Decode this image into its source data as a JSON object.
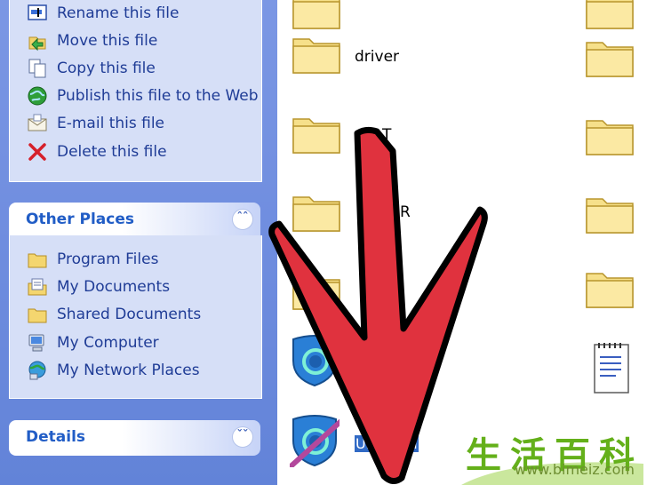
{
  "file_tasks": {
    "items": [
      {
        "label": "Rename this file",
        "icon": "rename-icon"
      },
      {
        "label": "Move this file",
        "icon": "move-icon"
      },
      {
        "label": "Copy this file",
        "icon": "copy-icon"
      },
      {
        "label": "Publish this file to the Web",
        "icon": "globe-icon"
      },
      {
        "label": "E-mail this file",
        "icon": "email-icon"
      },
      {
        "label": "Delete this file",
        "icon": "delete-icon"
      }
    ]
  },
  "other_places": {
    "title": "Other Places",
    "items": [
      {
        "label": "Program Files",
        "icon": "folder-icon"
      },
      {
        "label": "My Documents",
        "icon": "my-documents-icon"
      },
      {
        "label": "Shared Documents",
        "icon": "folder-icon"
      },
      {
        "label": "My Computer",
        "icon": "computer-icon"
      },
      {
        "label": "My Network Places",
        "icon": "network-icon"
      }
    ]
  },
  "details": {
    "title": "Details"
  },
  "files": {
    "visible_labels": [
      "driver",
      "T",
      "R"
    ],
    "selected_label": "Uninstall"
  },
  "watermark": {
    "chars": "生活百科",
    "url": "www.bimeiz.com"
  },
  "colors": {
    "pane_blue": "#6f8ddf",
    "panel_body": "#d6dff7",
    "title_blue": "#215dc6",
    "arrow_red": "#e0323e",
    "selection": "#316ac5"
  }
}
